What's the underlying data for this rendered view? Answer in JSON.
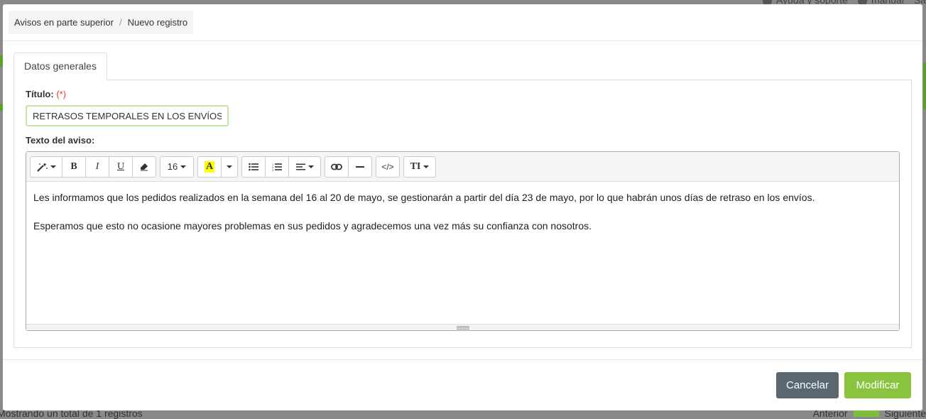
{
  "background": {
    "top_right_links": [
      "Ayuda y soporte",
      "manual",
      "Sa"
    ],
    "bottom_left_text": "Mostrando un total de 1 registros",
    "bottom_right_links": [
      "Anterior",
      "Siguiente"
    ]
  },
  "breadcrumb": {
    "items": [
      "Avisos en parte superior",
      "Nuevo registro"
    ],
    "separator": "/"
  },
  "tabs": [
    {
      "label": "Datos generales",
      "active": true
    }
  ],
  "form": {
    "title_label": "Título:",
    "required_mark": "(*)",
    "title_value": "RETRASOS TEMPORALES EN LOS ENVÍOS",
    "text_label": "Texto del aviso:"
  },
  "editor": {
    "toolbar": {
      "style_icon": "magic-wand-icon",
      "bold": "B",
      "italic": "I",
      "underline": "U",
      "eraser_icon": "eraser-icon",
      "font_size": "16",
      "color_letter": "A",
      "list_unordered_icon": "list-ul-icon",
      "list_ordered_icon": "list-ol-icon",
      "align_icon": "align-left-icon",
      "link_icon": "link-icon",
      "hr_icon": "minus-icon",
      "code_view": "</>",
      "text_style": "TI"
    },
    "paragraphs": [
      "Les informamos que los pedidos realizados en la semana del 16 al 20 de mayo, se gestionarán a partir del día 23 de mayo, por lo que habrán unos días de retraso en los envíos.",
      "Esperamos que esto no ocasione mayores problemas en sus pedidos y agradecemos una vez más su confianza con nosotros."
    ]
  },
  "footer": {
    "cancel_label": "Cancelar",
    "modify_label": "Modificar"
  },
  "colors": {
    "primary": "#8ac43f",
    "cancel": "#5a6670",
    "required": "#e23b3b",
    "highlight": "#ffff00"
  }
}
